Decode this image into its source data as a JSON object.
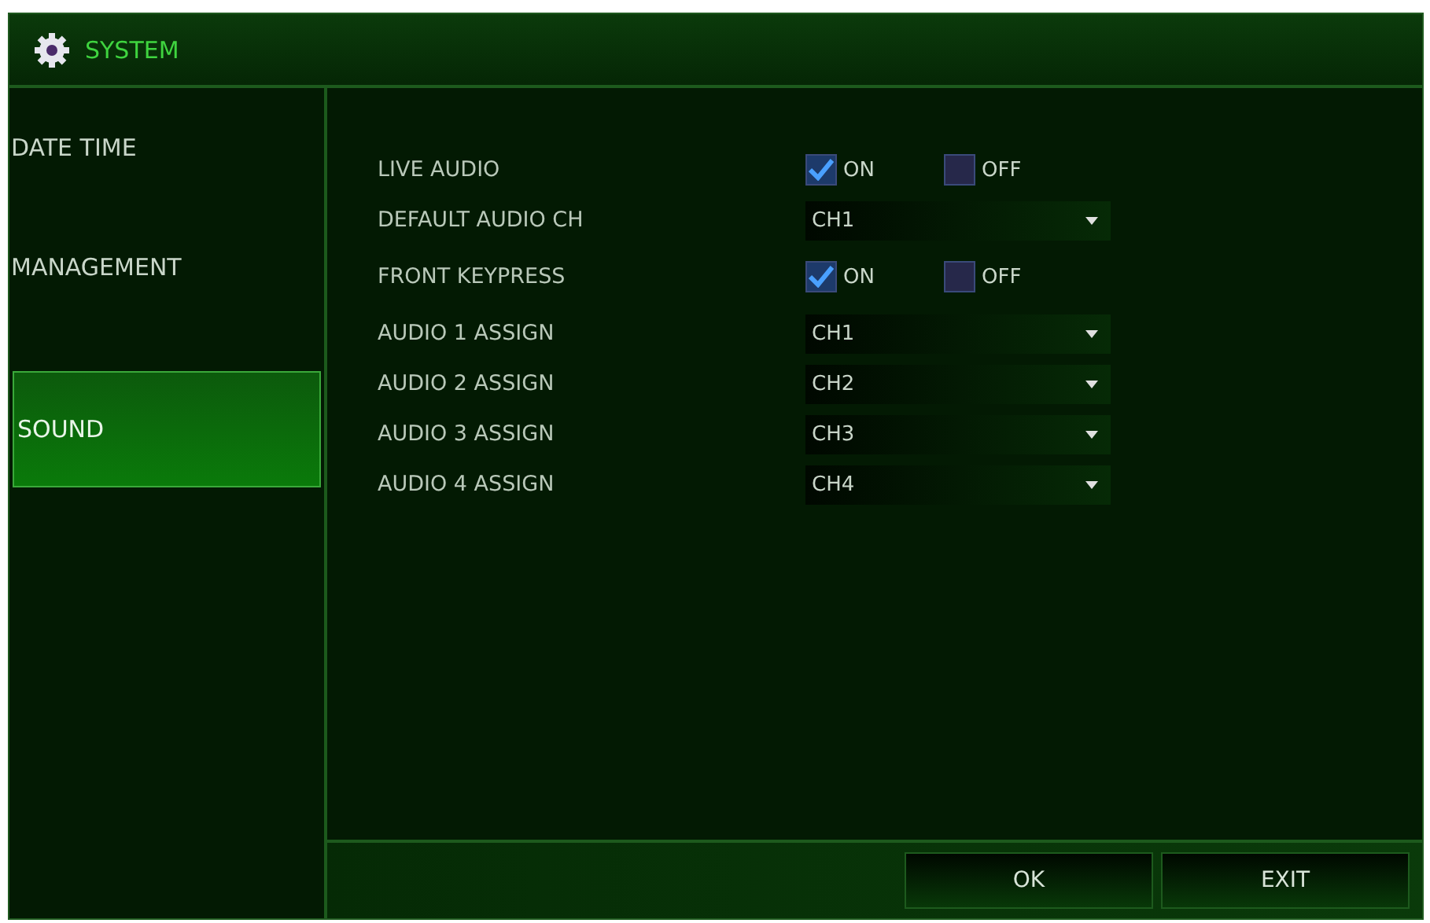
{
  "window": {
    "title": "SYSTEM"
  },
  "sidebar": {
    "items": [
      {
        "label": "DATE TIME",
        "selected": false
      },
      {
        "label": "MANAGEMENT",
        "selected": false
      },
      {
        "label": "SOUND",
        "selected": true
      }
    ]
  },
  "settings": [
    {
      "kind": "toggle",
      "label": "LIVE AUDIO",
      "options": [
        {
          "label": "ON",
          "checked": true
        },
        {
          "label": "OFF",
          "checked": false
        }
      ]
    },
    {
      "kind": "select",
      "label": "DEFAULT AUDIO CH",
      "value": "CH1"
    },
    {
      "kind": "toggle",
      "label": "FRONT KEYPRESS",
      "options": [
        {
          "label": "ON",
          "checked": true
        },
        {
          "label": "OFF",
          "checked": false
        }
      ]
    },
    {
      "kind": "select",
      "label": "AUDIO 1 ASSIGN",
      "value": "CH1"
    },
    {
      "kind": "select",
      "label": "AUDIO 2 ASSIGN",
      "value": "CH2"
    },
    {
      "kind": "select",
      "label": "AUDIO 3 ASSIGN",
      "value": "CH3"
    },
    {
      "kind": "select",
      "label": "AUDIO 4 ASSIGN",
      "value": "CH4"
    }
  ],
  "buttons": [
    "OK",
    "EXIT"
  ]
}
